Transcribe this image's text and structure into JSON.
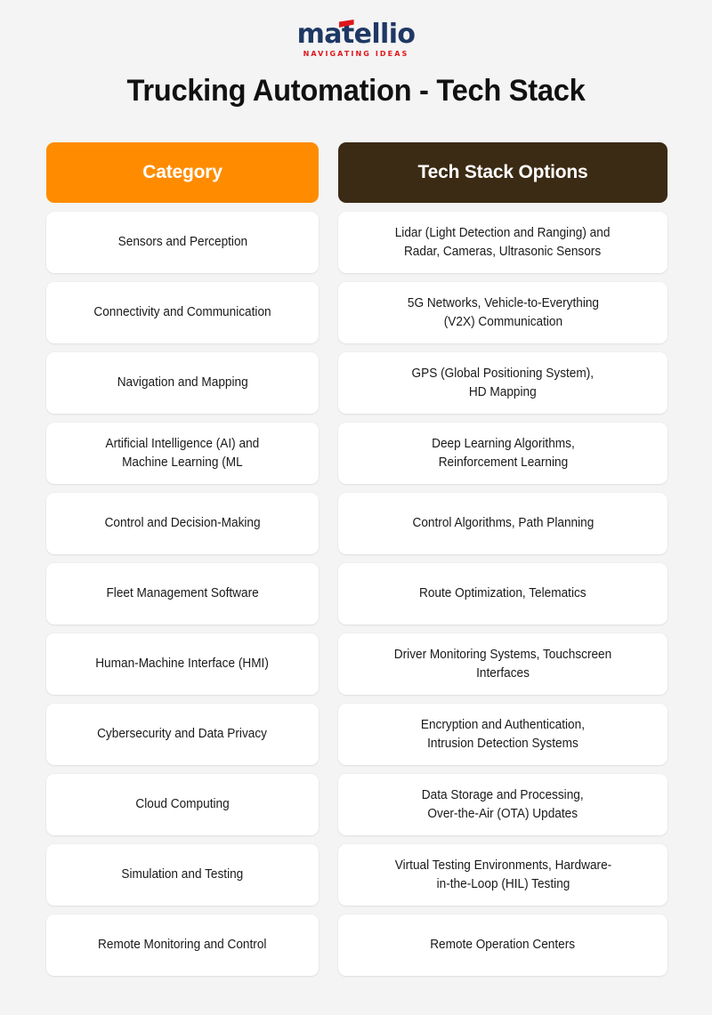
{
  "logo": {
    "word": "matellio",
    "tagline": "NAVIGATING IDEAS",
    "word_color": "#1f3864",
    "accent_color": "#e0161c"
  },
  "title": "Trucking Automation - Tech Stack",
  "colors": {
    "background": "#f4f4f4",
    "header_left": "#ff8c00",
    "header_right": "#3b2a14",
    "card": "#ffffff",
    "text": "#1a1a1a"
  },
  "table": {
    "headers": {
      "left": "Category",
      "right": "Tech Stack Options"
    },
    "rows": [
      {
        "category": "Sensors and Perception",
        "tech": "Lidar (Light Detection and Ranging) and\nRadar, Cameras, Ultrasonic Sensors"
      },
      {
        "category": "Connectivity and Communication",
        "tech": "5G Networks, Vehicle-to-Everything\n(V2X) Communication"
      },
      {
        "category": "Navigation and Mapping",
        "tech": "GPS (Global Positioning System),\nHD Mapping"
      },
      {
        "category": "Artificial Intelligence (AI) and\nMachine Learning (ML",
        "tech": "Deep Learning Algorithms,\nReinforcement Learning"
      },
      {
        "category": "Control and Decision-Making",
        "tech": "Control Algorithms, Path Planning"
      },
      {
        "category": "Fleet Management Software",
        "tech": "Route Optimization, Telematics"
      },
      {
        "category": "Human-Machine Interface (HMI)",
        "tech": "Driver Monitoring Systems, Touchscreen\nInterfaces"
      },
      {
        "category": "Cybersecurity and Data Privacy",
        "tech": "Encryption and Authentication,\nIntrusion Detection Systems"
      },
      {
        "category": "Cloud Computing",
        "tech": "Data Storage and Processing,\nOver-the-Air (OTA) Updates"
      },
      {
        "category": "Simulation and Testing",
        "tech": "Virtual Testing Environments, Hardware-\nin-the-Loop (HIL) Testing"
      },
      {
        "category": "Remote Monitoring and Control",
        "tech": "Remote Operation Centers"
      }
    ]
  }
}
